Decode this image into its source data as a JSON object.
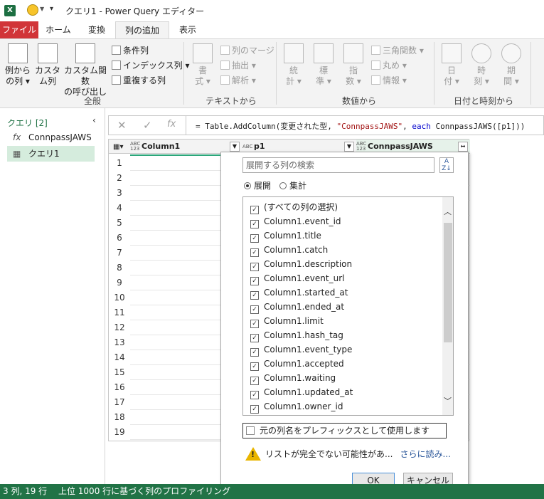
{
  "window": {
    "title": "クエリ1 - Power Query エディター"
  },
  "tabs": [
    "ファイル",
    "ホーム",
    "変換",
    "列の追加",
    "表示"
  ],
  "ribbon": {
    "general": {
      "example_column": [
        "例から",
        "の列"
      ],
      "custom_column": [
        "カスタ",
        "ム列"
      ],
      "custom_function": [
        "カスタム関数",
        "の呼び出し"
      ],
      "conditional_column": "条件列",
      "index_column": "インデックス列",
      "duplicate_column": "重複する列",
      "group_label": "全般"
    },
    "text": {
      "format": [
        "書",
        "式"
      ],
      "merge_columns": "列のマージ",
      "extract": "抽出",
      "parse": "解析",
      "group_label": "テキストから"
    },
    "number": {
      "statistics": [
        "統",
        "計"
      ],
      "standard": [
        "標",
        "準"
      ],
      "scientific": [
        "指",
        "数"
      ],
      "trigonometry": "三角関数",
      "rounding": "丸め",
      "information": "情報",
      "group_label": "数値から"
    },
    "datetime": {
      "date": [
        "日",
        "付"
      ],
      "time": [
        "時",
        "刻"
      ],
      "duration": [
        "期",
        "間"
      ],
      "group_label": "日付と時刻から"
    }
  },
  "queries": {
    "header": "クエリ [2]",
    "items": [
      {
        "label": "ConnpassJAWS",
        "icon": "fx-icon"
      },
      {
        "label": "クエリ1",
        "icon": "table-icon"
      }
    ]
  },
  "formula_bar": {
    "prefix": "= Table.AddColumn(変更された型, ",
    "string": "\"ConnpassJAWS\"",
    "sep": ", ",
    "keyword": "each",
    "suffix": " ConnpassJAWS([p1]))"
  },
  "grid": {
    "columns": [
      {
        "type": "ABC 123",
        "name": "Column1"
      },
      {
        "type": "ABC",
        "name": "p1"
      },
      {
        "type": "ABC 123",
        "name": "ConnpassJAWS"
      }
    ],
    "rows": [
      "1",
      "2",
      "3",
      "4",
      "5",
      "6",
      "7",
      "8",
      "9",
      "10",
      "11",
      "12",
      "13",
      "14",
      "15",
      "16",
      "17",
      "18",
      "19"
    ]
  },
  "expand_dropdown": {
    "search_placeholder": "展開する列の検索",
    "mode_expand": "展開",
    "mode_aggregate": "集計",
    "options": [
      "(すべての列の選択)",
      "Column1.event_id",
      "Column1.title",
      "Column1.catch",
      "Column1.description",
      "Column1.event_url",
      "Column1.started_at",
      "Column1.ended_at",
      "Column1.limit",
      "Column1.hash_tag",
      "Column1.event_type",
      "Column1.accepted",
      "Column1.waiting",
      "Column1.updated_at",
      "Column1.owner_id"
    ],
    "prefix_checkbox": "元の列名をプレフィックスとして使用します",
    "warning": "リストが完全でない可能性があ...",
    "load_more": "さらに読み...",
    "ok": "OK",
    "cancel": "キャンセル"
  },
  "status": {
    "text": "3 列, 19 行　 上位 1000 行に基づく列のプロファイリング"
  }
}
